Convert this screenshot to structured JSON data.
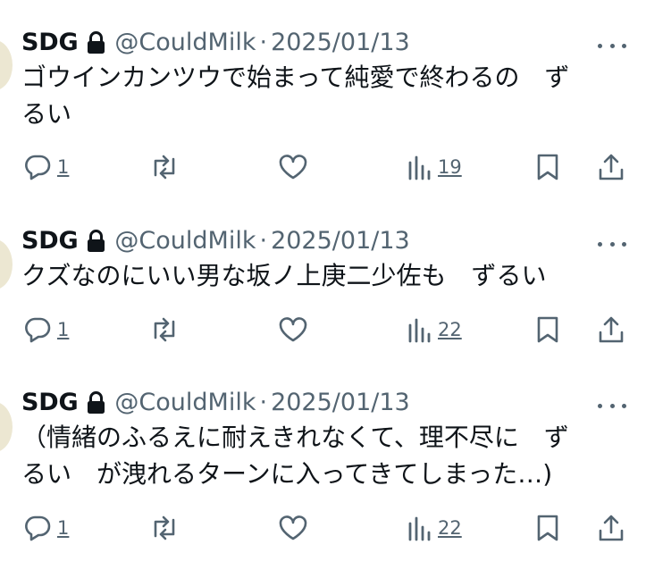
{
  "tweets": [
    {
      "name": "SDG",
      "handle": "@CouldMilk",
      "separator": "·",
      "date": "2025/01/13",
      "text_lines": [
        "ゴウインカンツウで始まって純愛で終わるの　ず",
        "るい"
      ],
      "replies": "1",
      "views": "19"
    },
    {
      "name": "SDG",
      "handle": "@CouldMilk",
      "separator": "·",
      "date": "2025/01/13",
      "text_lines": [
        "クズなのにいい男な坂ノ上庚二少佐も　ずるい"
      ],
      "replies": "1",
      "views": "22"
    },
    {
      "name": "SDG",
      "handle": "@CouldMilk",
      "separator": "·",
      "date": "2025/01/13",
      "text_lines": [
        "（情緒のふるえに耐えきれなくて、理不尽に　ず",
        "るい　が洩れるターンに入ってきてしまった…)"
      ],
      "replies": "1",
      "views": "22"
    }
  ],
  "icons": {
    "lock": "lock-icon",
    "more": "more-icon",
    "reply": "reply-icon",
    "repost": "repost-icon",
    "like": "like-icon",
    "views": "views-icon",
    "bookmark": "bookmark-icon",
    "share": "share-icon"
  },
  "colors": {
    "text": "#0f1419",
    "secondary": "#536471",
    "background": "#ffffff"
  }
}
